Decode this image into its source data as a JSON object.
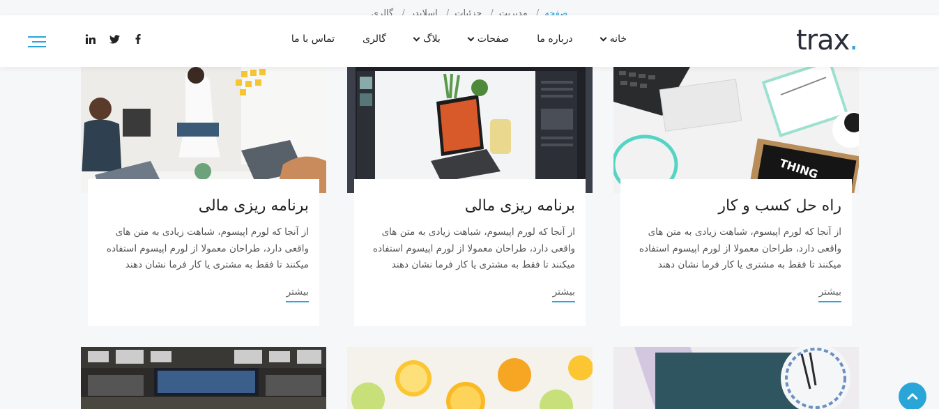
{
  "breadcrumb": {
    "items": [
      "صفحه",
      "مدیریت",
      "جزئیات",
      "اسلایدر",
      "گالری"
    ]
  },
  "header": {
    "logo_text": "trax",
    "logo_dot": ".",
    "nav": [
      {
        "label": "خانه",
        "has_dropdown": true
      },
      {
        "label": "درباره ما",
        "has_dropdown": false
      },
      {
        "label": "صفحات",
        "has_dropdown": true
      },
      {
        "label": "بلاگ",
        "has_dropdown": true
      },
      {
        "label": "گالری",
        "has_dropdown": false
      },
      {
        "label": "تماس با ما",
        "has_dropdown": false
      }
    ],
    "socials": [
      "facebook-icon",
      "twitter-icon",
      "linkedin-icon"
    ]
  },
  "cards": [
    {
      "title": "راه حل کسب و کار",
      "text": "از آنجا که لورم اپیسوم، شباهت زیادی به متن های واقعی دارد، طراحان معمولا از لورم اپیسوم استفاده میکنند تا فقط به مشتری یا کار فرما نشان دهند",
      "more": "بیشتر"
    },
    {
      "title": "برنامه ریزی مالی",
      "text": "از آنجا که لورم اپیسوم، شباهت زیادی به متن های واقعی دارد، طراحان معمولا از لورم اپیسوم استفاده میکنند تا فقط به مشتری یا کار فرما نشان دهند",
      "more": "بیشتر"
    },
    {
      "title": "برنامه ریزی مالی",
      "text": "از آنجا که لورم اپیسوم، شباهت زیادی به متن های واقعی دارد، طراحان معمولا از لورم اپیسوم استفاده میکنند تا فقط به مشتری یا کار فرما نشان دهند",
      "more": "بیشتر"
    }
  ],
  "colors": {
    "accent": "#2aa5d8",
    "text": "#222222",
    "background": "#f6f7f9"
  }
}
